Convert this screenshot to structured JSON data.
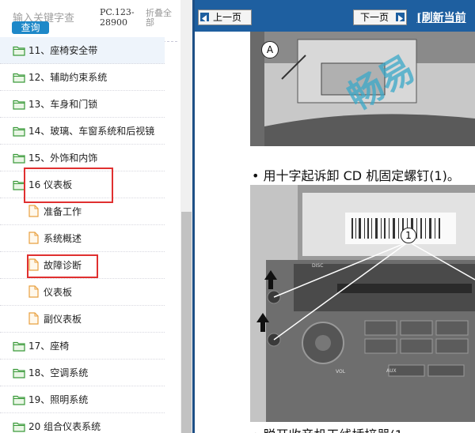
{
  "search": {
    "placeholder": "输入关键字查",
    "button": "查询"
  },
  "doc_code": "PC.123-28900",
  "collapse_label": "折叠全部",
  "tree": [
    {
      "label": "11、座椅安全带",
      "type": "folder",
      "selected": true
    },
    {
      "label": "12、辅助约束系统",
      "type": "folder"
    },
    {
      "label": "13、车身和门锁",
      "type": "folder"
    },
    {
      "label": "14、玻璃、车窗系统和后视镜",
      "type": "folder"
    },
    {
      "label": "15、外饰和内饰",
      "type": "folder"
    },
    {
      "label": "16 仪表板",
      "type": "folder",
      "highlighted": true
    },
    {
      "label": "准备工作",
      "type": "doc"
    },
    {
      "label": "系统概述",
      "type": "doc"
    },
    {
      "label": "故障诊断",
      "type": "doc",
      "highlighted": true
    },
    {
      "label": "仪表板",
      "type": "doc"
    },
    {
      "label": "副仪表板",
      "type": "doc"
    },
    {
      "label": "17、座椅",
      "type": "folder"
    },
    {
      "label": "18、空调系统",
      "type": "folder"
    },
    {
      "label": "19、照明系统",
      "type": "folder"
    },
    {
      "label": "20 组合仪表系统",
      "type": "folder"
    }
  ],
  "nav": {
    "prev": "上一页",
    "next": "下一页",
    "refresh": "[刷新当前"
  },
  "content": {
    "callout_a": "A",
    "callout_1": "1",
    "step1": "• 用十字起诉卸 CD 机固定螺钉(1)。",
    "step2": "• 脱开收音机天线插接器(1",
    "panel_labels": [
      "DISC",
      "AUX",
      "VOL"
    ]
  },
  "colors": {
    "nav_blue": "#1e5fa0",
    "highlight_red": "#e03030",
    "search_blue": "#1e88c8",
    "folder_green": "#3a9a3a",
    "doc_orange": "#e8a040"
  }
}
